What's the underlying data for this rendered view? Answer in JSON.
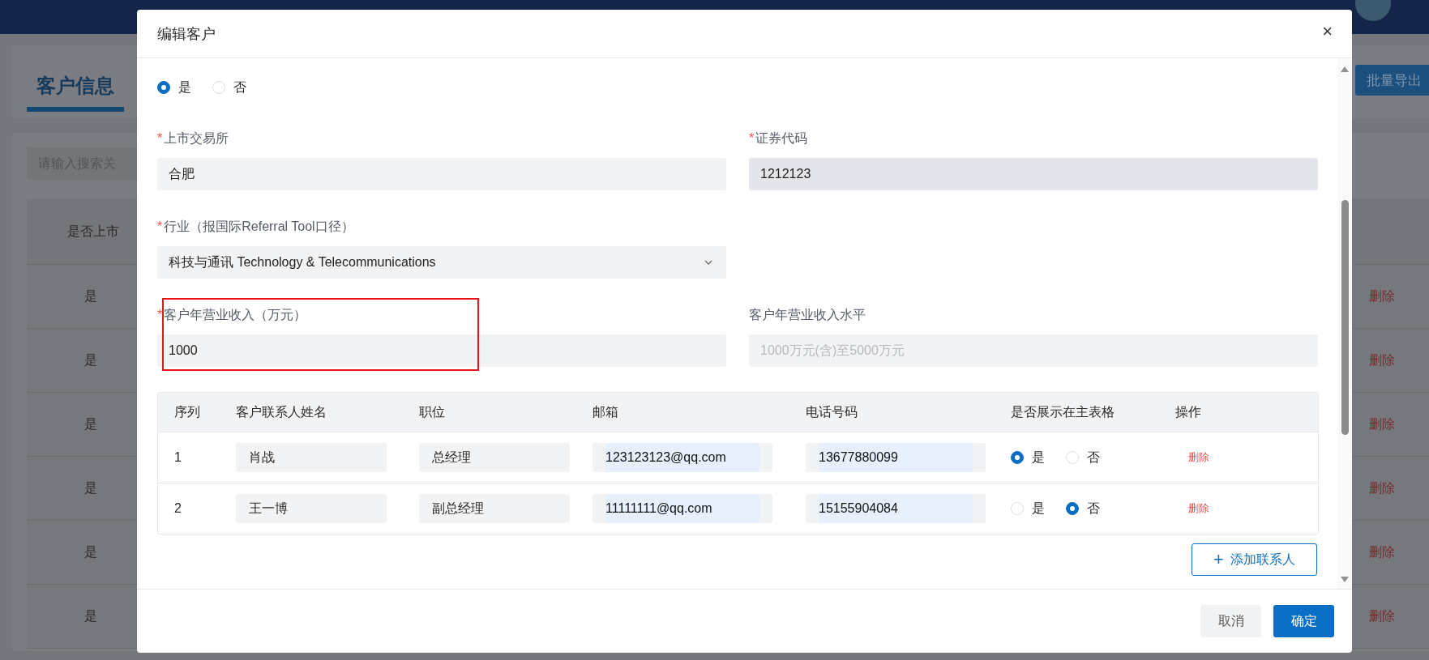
{
  "page": {
    "tab": "客户信息",
    "export_button": "批量导出",
    "search": {
      "placeholder": "请输入搜索关"
    },
    "table": {
      "column": "是否上市",
      "rows": [
        {
          "listed": "是",
          "action": "删除"
        },
        {
          "listed": "是",
          "action": "删除"
        },
        {
          "listed": "是",
          "action": "删除"
        },
        {
          "listed": "是",
          "action": "删除"
        },
        {
          "listed": "是",
          "action": "删除"
        },
        {
          "listed": "是",
          "action": "删除"
        }
      ]
    }
  },
  "dialog": {
    "title": "编辑客户",
    "close": "×",
    "listed_options": [
      {
        "label": "是",
        "selected": true
      },
      {
        "label": "否",
        "selected": false
      }
    ],
    "form_rows": [
      [
        {
          "kind": "input",
          "required_mark": "*",
          "label": "上市交易所",
          "value": "合肥",
          "readonly": false,
          "disabled": false,
          "highlighted": false
        },
        {
          "kind": "input",
          "required_mark": "*",
          "label": "证券代码",
          "value": "1212123",
          "readonly": true,
          "disabled": false,
          "highlighted": false
        }
      ],
      [
        {
          "kind": "select",
          "required_mark": "*",
          "label": "行业（报国际Referral Tool口径）",
          "value": "科技与通讯 Technology & Telecommunications",
          "readonly": false,
          "disabled": false,
          "highlighted": false
        }
      ],
      [
        {
          "kind": "input",
          "required_mark": "*",
          "label": "客户年营业收入（万元）",
          "value": "1000",
          "readonly": false,
          "disabled": false,
          "highlighted": true
        },
        {
          "kind": "input",
          "label": "客户年营业收入水平",
          "value": "1000万元(含)至5000万元",
          "readonly": false,
          "disabled": true,
          "highlighted": false
        }
      ]
    ],
    "contacts": {
      "columns": [
        "序列",
        "客户联系人姓名",
        "职位",
        "邮箱",
        "电话号码",
        "是否展示在主表格",
        "操作"
      ],
      "rows": [
        {
          "index": "1",
          "name": "肖战",
          "position": "总经理",
          "email": "123123123@qq.com",
          "phone": "13677880099",
          "show": [
            {
              "label": "是",
              "selected": true
            },
            {
              "label": "否",
              "selected": false
            }
          ],
          "action": "删除"
        },
        {
          "index": "2",
          "name": "王一博",
          "position": "副总经理",
          "email": "11111111@qq.com",
          "phone": "15155904084",
          "show": [
            {
              "label": "是",
              "selected": false
            },
            {
              "label": "否",
              "selected": true
            }
          ],
          "action": "删除"
        }
      ]
    },
    "add_button": "添加联系人",
    "plus": "+",
    "buttons": [
      {
        "label": "取消",
        "kind": "secondary"
      },
      {
        "label": "确定",
        "kind": "primary"
      }
    ]
  }
}
